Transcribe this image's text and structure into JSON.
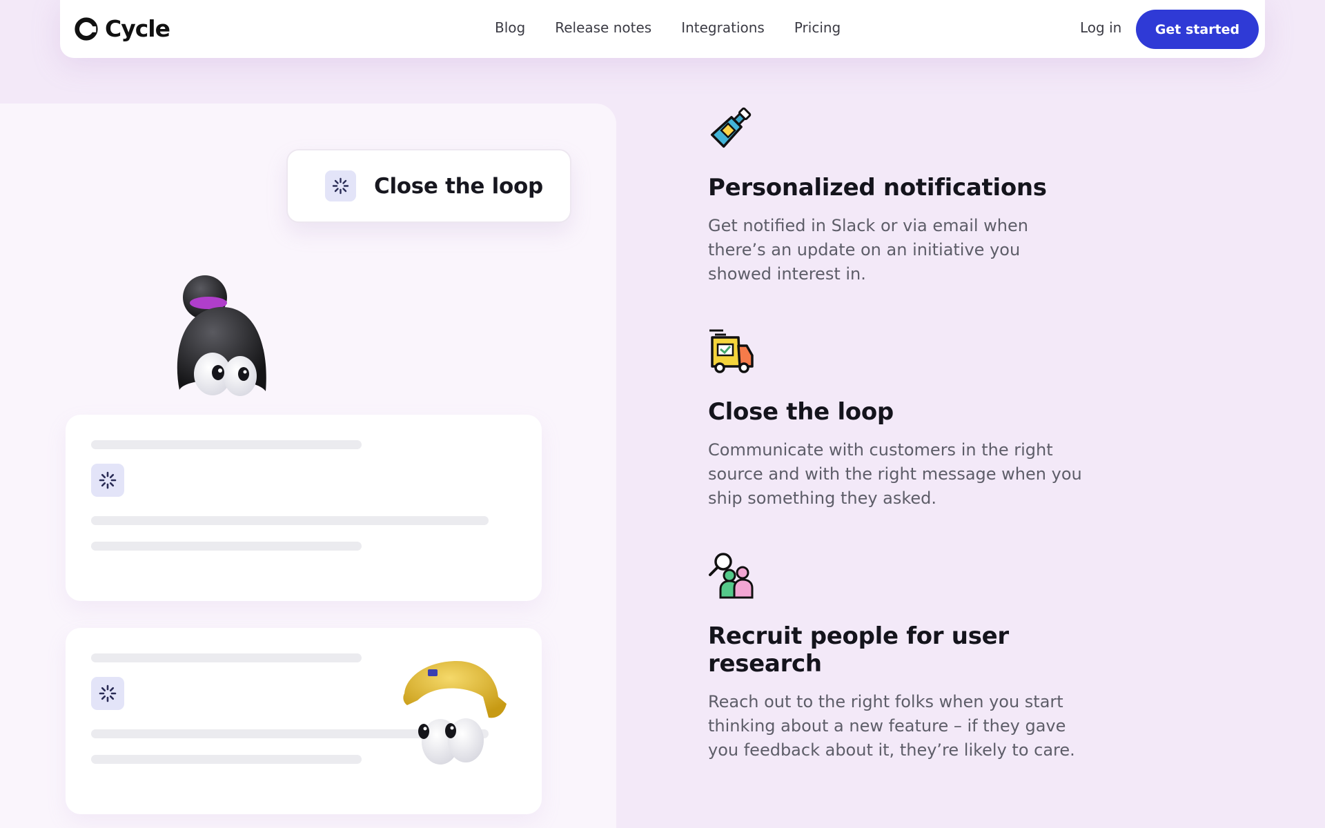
{
  "brand": {
    "name": "Cycle"
  },
  "nav": {
    "links": [
      "Blog",
      "Release notes",
      "Integrations",
      "Pricing"
    ],
    "login": "Log in",
    "cta": "Get started"
  },
  "showcase": {
    "tag_label": "Close the loop"
  },
  "features": [
    {
      "icon": "bottle-icon",
      "title": "Personalized notifications",
      "description": "Get notified in Slack or via email when there’s an update on an initiative you showed interest in."
    },
    {
      "icon": "delivery-truck-icon",
      "title": "Close the loop",
      "description": "Communicate with customers in the right source and with the right message when you ship something they asked."
    },
    {
      "icon": "people-search-icon",
      "title": "Recruit people for user research",
      "description": "Reach out to the right folks when you start thinking about a new feature – if they gave you feedback about it, they’re likely to care."
    }
  ],
  "colors": {
    "background": "#f3e9f8",
    "accent": "#2f3ad6",
    "panel": "#faf5fc"
  }
}
